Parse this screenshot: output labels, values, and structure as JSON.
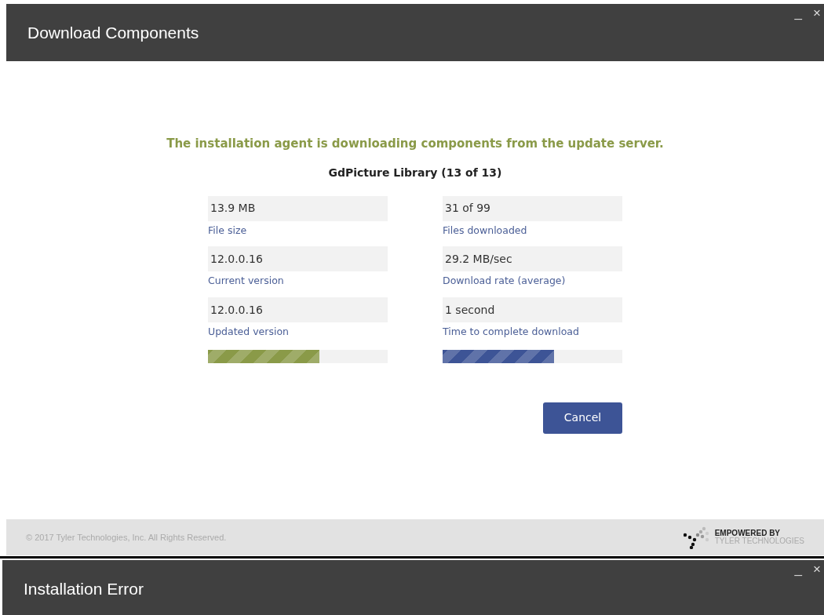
{
  "windows": [
    {
      "title": "Download Components",
      "controls": [
        "_",
        "×"
      ],
      "message": "The installation agent is downloading components from the update server.",
      "component": "GdPicture Library (13 of 13)",
      "columns": [
        {
          "fields": [
            {
              "value": "13.9 MB",
              "label": "File size"
            },
            {
              "value": "12.0.0.16",
              "label": "Current version"
            },
            {
              "value": "12.0.0.16",
              "label": "Updated version"
            }
          ],
          "progress": {
            "level": 0.62,
            "color": "#8a9a48"
          }
        },
        {
          "fields": [
            {
              "value": "31 of 99",
              "label": "Files downloaded"
            },
            {
              "value": "29.2 MB/sec",
              "label": "Download rate (average)"
            },
            {
              "value": "1 second",
              "label": "Time to complete download"
            }
          ],
          "progress": {
            "level": 0.62,
            "color": "#3d5496"
          }
        }
      ],
      "button": "Cancel",
      "footer": {
        "copyright": "© 2017 Tyler Technologies, Inc. All Rights Reserved.",
        "brand_top": "EMPOWERED BY",
        "brand_bottom": "TYLER TECHNOLOGIES"
      }
    },
    {
      "title": "Installation Error",
      "controls": [
        "_",
        "×"
      ]
    }
  ]
}
